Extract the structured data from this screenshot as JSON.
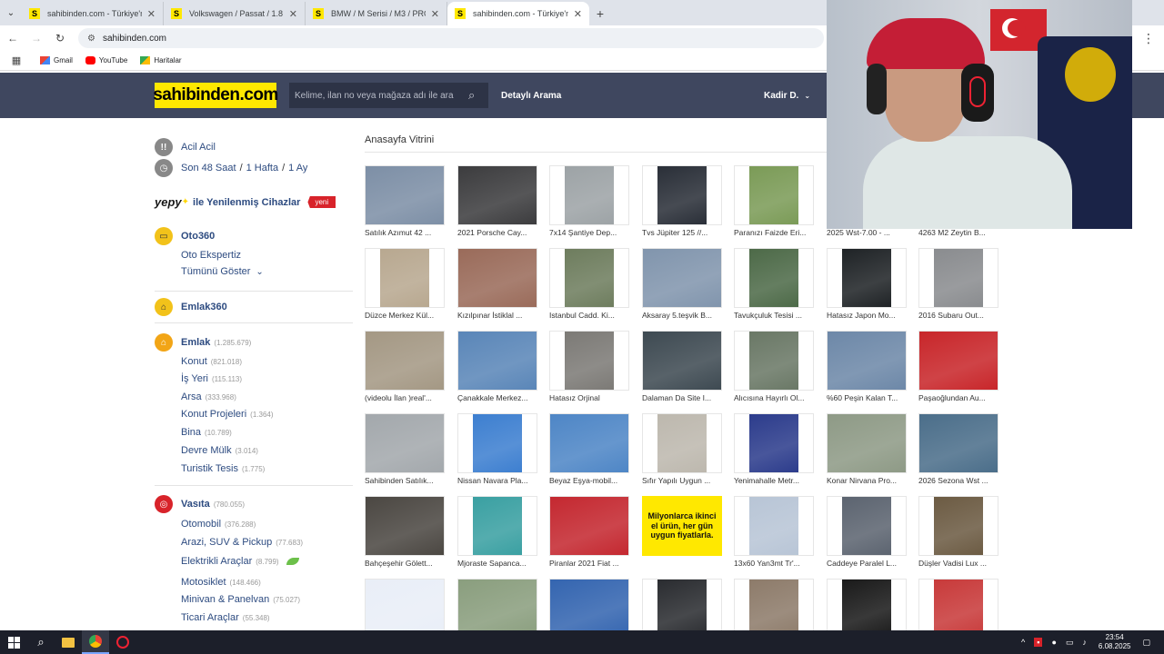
{
  "browser": {
    "tabs": [
      {
        "title": "sahibinden.com - Türkiye'nin Online Pazarı",
        "active": false
      },
      {
        "title": "Volkswagen / Passat / 1.8 T / Comfortline",
        "active": false
      },
      {
        "title": "BMW / M Serisi / M3 / PROJECT",
        "active": false
      },
      {
        "title": "sahibinden.com - Türkiye'nin Online Pazarı",
        "active": true
      }
    ],
    "address": "sahibinden.com",
    "bookmarks": [
      "Gmail",
      "YouTube",
      "Haritalar"
    ]
  },
  "header": {
    "logo": "sahibinden.com",
    "search_placeholder": "Kelime, ilan no veya mağaza adı ile ara",
    "advanced_search": "Detaylı Arama",
    "user": "Kadir D."
  },
  "sidebar": {
    "acil": "Acil Acil",
    "recent": [
      "Son 48 Saat",
      "/",
      "1 Hafta",
      "/",
      "1 Ay"
    ],
    "yepy_logo": "yepy",
    "yepy_text": "ile Yenilenmiş Cihazlar",
    "yepy_badge": "yeni",
    "oto360": "Oto360",
    "oto_ekspertiz": "Oto Ekspertiz",
    "show_all": "Tümünü Göster",
    "emlak360": "Emlak360",
    "emlak": {
      "label": "Emlak",
      "count": "(1.285.679)"
    },
    "emlak_items": [
      {
        "label": "Konut",
        "count": "(821.018)"
      },
      {
        "label": "İş Yeri",
        "count": "(115.113)"
      },
      {
        "label": "Arsa",
        "count": "(333.968)"
      },
      {
        "label": "Konut Projeleri",
        "count": "(1.364)"
      },
      {
        "label": "Bina",
        "count": "(10.789)"
      },
      {
        "label": "Devre Mülk",
        "count": "(3.014)"
      },
      {
        "label": "Turistik Tesis",
        "count": "(1.775)"
      }
    ],
    "vasita": {
      "label": "Vasıta",
      "count": "(780.055)"
    },
    "vasita_items": [
      {
        "label": "Otomobil",
        "count": "(376.288)"
      },
      {
        "label": "Arazi, SUV & Pickup",
        "count": "(77.683)"
      },
      {
        "label": "Elektrikli Araçlar",
        "count": "(8.799)"
      },
      {
        "label": "Motosiklet",
        "count": "(148.466)"
      },
      {
        "label": "Minivan & Panelvan",
        "count": "(75.027)"
      },
      {
        "label": "Ticari Araçlar",
        "count": "(55.348)"
      }
    ]
  },
  "showcase": {
    "title": "Anasayfa Vitrini",
    "promo_text": "Milyonlarca ikinci el ürün, her gün uygun fiyatlarla.",
    "items": [
      {
        "caption": "Satılık Azımut 42 ...",
        "color": "#7d8fa6"
      },
      {
        "caption": "2021 Porsche Cay...",
        "color": "#3c3c3e"
      },
      {
        "caption": "7x14 Şantiye Dep...",
        "color": "#9da3a6"
      },
      {
        "caption": "Tvs Jüpiter 125 //...",
        "color": "#2a2f38"
      },
      {
        "caption": "Paranızı Faizde Eri...",
        "color": "#7b9b57"
      },
      {
        "caption": "2025 Wst-7.00 - ...",
        "color": "#9fb5c8"
      },
      {
        "caption": "4263 M2 Zeytin B...",
        "color": "#8a9a6a"
      },
      {
        "caption": "Düzce Merkez Kül...",
        "color": "#b8a890"
      },
      {
        "caption": "Kızılpınar İstiklal ...",
        "color": "#9a6b5a"
      },
      {
        "caption": "Istanbul Cadd. Ki...",
        "color": "#6e7d5e"
      },
      {
        "caption": "Aksaray 5.teşvik B...",
        "color": "#8195ad"
      },
      {
        "caption": "Tavukçuluk Tesisi ...",
        "color": "#4d6a48"
      },
      {
        "caption": "Hatasız Japon Mo...",
        "color": "#1f2326"
      },
      {
        "caption": "2016 Subaru Out...",
        "color": "#8a8c8f"
      },
      {
        "caption": "(videolu İlan )real'...",
        "color": "#a49884"
      },
      {
        "caption": "Çanakkale Merkez...",
        "color": "#5a86b8"
      },
      {
        "caption": "Hatasız Orjinal",
        "color": "#7c7a76"
      },
      {
        "caption": "Dalaman Da Site I...",
        "color": "#3e4a52"
      },
      {
        "caption": "Alıcısına Hayırlı Ol...",
        "color": "#6a7866"
      },
      {
        "caption": "%60 Peşin Kalan T...",
        "color": "#6d88a8"
      },
      {
        "caption": "Paşaoğlundan Au...",
        "color": "#c8262a"
      },
      {
        "caption": "Sahibinden Satılık...",
        "color": "#a3a8ac"
      },
      {
        "caption": "Nissan Navara Pla...",
        "color": "#3d7fd0"
      },
      {
        "caption": "Beyaz Eşya-mobil...",
        "color": "#4e86c6"
      },
      {
        "caption": "Sıfır Yapılı Uygun ...",
        "color": "#bdb8ae"
      },
      {
        "caption": "Yenimahalle Metr...",
        "color": "#2c3c8c"
      },
      {
        "caption": "Konar Nirvana Pro...",
        "color": "#8e9a86"
      },
      {
        "caption": "2026 Sezona Wst ...",
        "color": "#4b6e8a"
      },
      {
        "caption": "Bahçeşehir Gölett...",
        "color": "#4b4742"
      },
      {
        "caption": "Mjoraste Sapanca...",
        "color": "#3aa0a2"
      },
      {
        "caption": "Piranlar 2021 Fiat ...",
        "color": "#c42830"
      },
      {
        "caption": "",
        "color": "#ffe800"
      },
      {
        "caption": "13x60 Yan3mt Tr'...",
        "color": "#b8c5d6"
      },
      {
        "caption": "Caddeye Paralel L...",
        "color": "#5c6470"
      },
      {
        "caption": "Düşler Vadisi Lux ...",
        "color": "#6c5b43"
      },
      {
        "caption": "",
        "color": "#e9eef7"
      },
      {
        "caption": "",
        "color": "#8a9e7e"
      },
      {
        "caption": "",
        "color": "#3465b0"
      },
      {
        "caption": "",
        "color": "#2a2c30"
      },
      {
        "caption": "",
        "color": "#8d7b6a"
      },
      {
        "caption": "",
        "color": "#1a1a1a"
      },
      {
        "caption": "",
        "color": "#c83a3a"
      }
    ]
  },
  "taskbar": {
    "time": "23:54",
    "date": "6.08.2025"
  }
}
